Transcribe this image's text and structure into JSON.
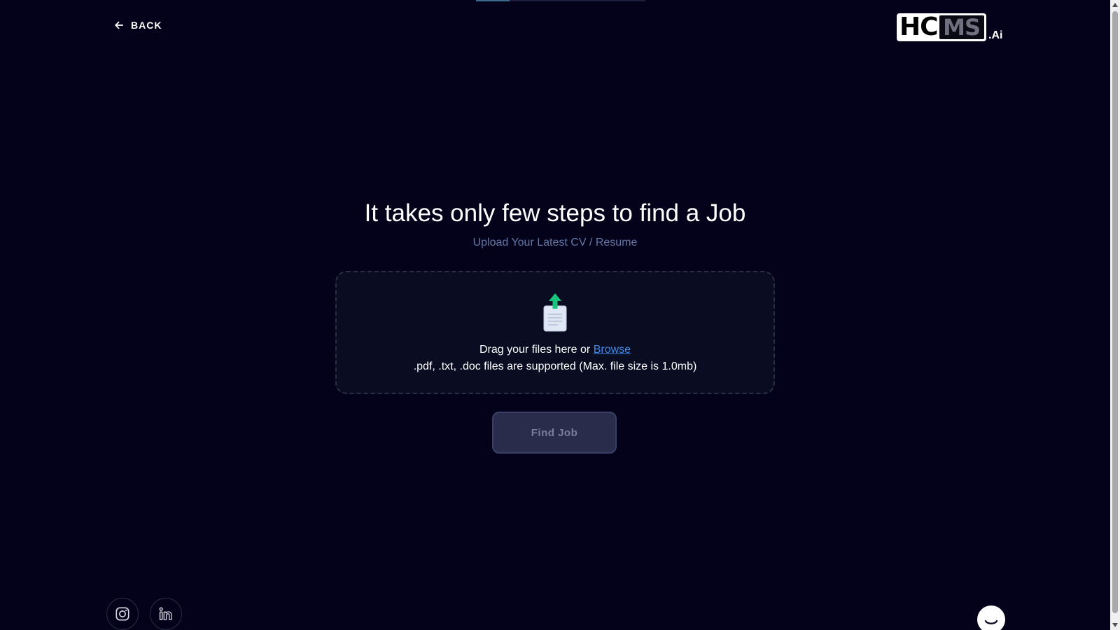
{
  "header": {
    "back_label": "BACK",
    "logo": {
      "primary": "HC",
      "secondary": "MS",
      "suffix": ".Ai"
    }
  },
  "upload_progress": {
    "fraction": 0.2
  },
  "hero": {
    "title": "It takes only few steps to find a Job",
    "subtitle": "Upload Your Latest CV / Resume"
  },
  "dropzone": {
    "prompt": "Drag your files here or ",
    "browse_label": "Browse",
    "supported_note": ".pdf, .txt, .doc files are supported (Max. file size is 1.0mb)"
  },
  "actions": {
    "find_job_label": "Find Job",
    "find_job_disabled": true
  },
  "social": [
    {
      "icon": "instagram-icon"
    },
    {
      "icon": "linkedin-icon"
    }
  ],
  "colors": {
    "background": "#03021a",
    "subtitle": "#6277a6",
    "link": "#3d8bea",
    "button_bg": "#292c4a",
    "upload_arrow": "#19c37d"
  }
}
